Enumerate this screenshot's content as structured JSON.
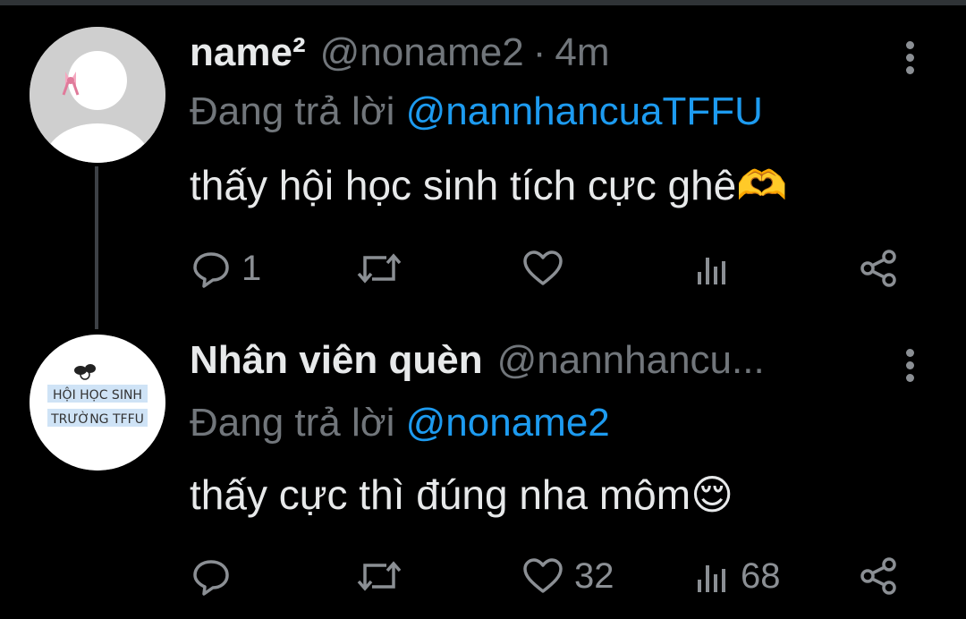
{
  "tweets": [
    {
      "name": "name²",
      "handle": "@noname2",
      "separator": "·",
      "time": "4m",
      "reply_prefix": "Đang trả lời",
      "reply_to": "@nannhancuaTFFU",
      "text": "thấy hội học sinh tích cực ghê",
      "emoji": "🫶",
      "counts": {
        "reply": "1",
        "retweet": "",
        "like": "",
        "views": ""
      }
    },
    {
      "name": "Nhân viên quèn",
      "handle": "@nannhancu...",
      "reply_prefix": "Đang trả lời",
      "reply_to": "@noname2",
      "text": "thấy cực thì đúng nha môm",
      "emoji": "😌",
      "avatar_text": [
        "HỘI HỌC SINH",
        "TRƯỜNG TFFU"
      ],
      "counts": {
        "reply": "",
        "retweet": "",
        "like": "32",
        "views": "68"
      }
    }
  ],
  "icons": [
    "reply-icon",
    "retweet-icon",
    "like-icon",
    "views-icon",
    "share-icon",
    "more-icon"
  ],
  "colors": {
    "background": "#000000",
    "text": "#e7e9ea",
    "muted": "#71767b",
    "mention": "#1d9bf0"
  }
}
